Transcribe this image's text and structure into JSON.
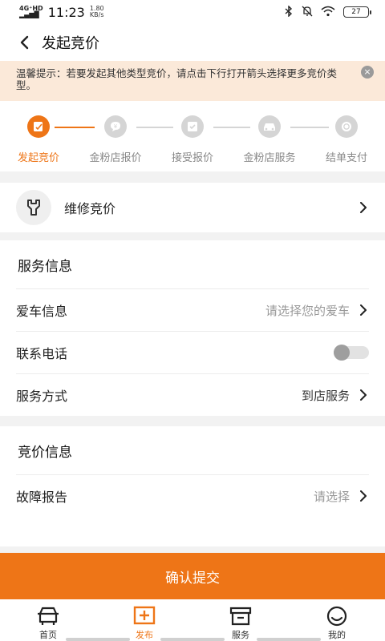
{
  "status_bar": {
    "network_top": "4G⁺HD",
    "network_bottom": "▂▄▆█",
    "time": "11:23",
    "speed_value": "1.80",
    "speed_unit": "KB/s",
    "battery": "27"
  },
  "header": {
    "title": "发起竞价"
  },
  "tip": {
    "text": "温馨提示：若要发起其他类型竞价，请点击下行打开箭头选择更多竞价类型。",
    "close_glyph": "×"
  },
  "steps": [
    {
      "label": "发起竞价",
      "active": true
    },
    {
      "label": "金粉店报价",
      "active": false
    },
    {
      "label": "接受报价",
      "active": false
    },
    {
      "label": "金粉店服务",
      "active": false
    },
    {
      "label": "结单支付",
      "active": false
    }
  ],
  "repair": {
    "label": "维修竞价"
  },
  "service_info": {
    "title": "服务信息",
    "car": {
      "label": "爱车信息",
      "placeholder": "请选择您的爱车"
    },
    "phone": {
      "label": "联系电话",
      "enabled": false
    },
    "method": {
      "label": "服务方式",
      "value": "到店服务"
    }
  },
  "bid_info": {
    "title": "竞价信息",
    "fault": {
      "label": "故障报告",
      "placeholder": "请选择"
    }
  },
  "submit_label": "确认提交",
  "tabbar": [
    {
      "label": "首页",
      "icon": "home-icon",
      "active": false
    },
    {
      "label": "发布",
      "icon": "publish-icon",
      "active": true
    },
    {
      "label": "服务",
      "icon": "service-icon",
      "active": false
    },
    {
      "label": "我的",
      "icon": "profile-icon",
      "active": false
    }
  ],
  "colors": {
    "accent": "#ee7517",
    "tip_bg": "#fbe9d9",
    "inactive": "#d5d5d5"
  }
}
